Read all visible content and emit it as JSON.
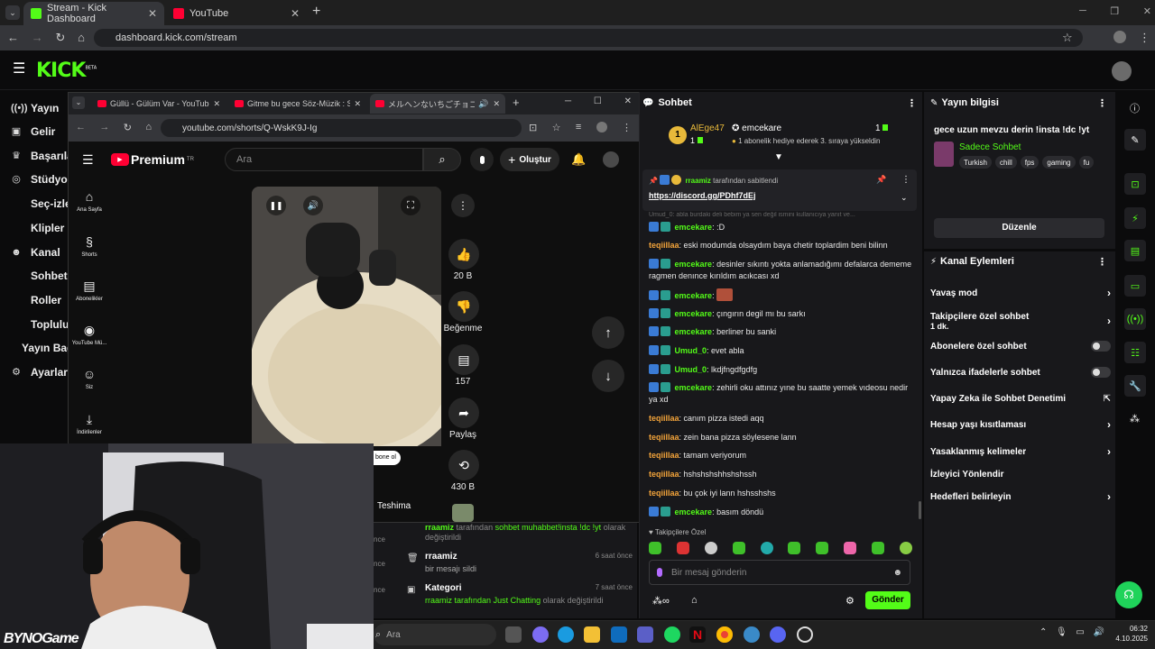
{
  "browser": {
    "tabs": [
      {
        "title": "Stream - Kick Dashboard",
        "active": true
      },
      {
        "title": "YouTube",
        "active": false
      }
    ],
    "url": "dashboard.kick.com/stream",
    "new_tab": "+"
  },
  "kick": {
    "logo": "KICK",
    "logo_badge": "BETA",
    "nav": [
      {
        "label": "Yayın",
        "icon": "broadcast-icon"
      },
      {
        "label": "Gelir",
        "icon": "money-icon"
      },
      {
        "label": "Başarıla",
        "icon": "trophy-icon"
      },
      {
        "label": "Stüdyo",
        "icon": "studio-icon"
      },
      {
        "label": "Seç-izle",
        "icon": ""
      },
      {
        "label": "Klipler",
        "icon": ""
      },
      {
        "label": "Kanal",
        "icon": "people-icon"
      },
      {
        "label": "Sohbet",
        "icon": ""
      },
      {
        "label": "Roller",
        "icon": ""
      },
      {
        "label": "Topluluk",
        "icon": ""
      },
      {
        "label": "Yayın Bağ",
        "icon": ""
      },
      {
        "label": "Ayarlar",
        "icon": "gear-icon"
      }
    ]
  },
  "youtube_window": {
    "tabs": [
      {
        "title": "Güllü - Gülüm Var - YouTube"
      },
      {
        "title": "Gitme bu gece Söz-Müzik : Sa"
      },
      {
        "title": "メルヘンないちごチョコクレープ"
      }
    ],
    "url": "youtube.com/shorts/Q-WskK9J-Ig",
    "brand": "Premium",
    "brand_region": "TR",
    "search_placeholder": "Ara",
    "create_label": "Oluştur",
    "sidebar": [
      {
        "label": "Ana Sayfa",
        "icon": "home-icon"
      },
      {
        "label": "Shorts",
        "icon": "shorts-icon"
      },
      {
        "label": "Abonelikler",
        "icon": "subscriptions-icon"
      },
      {
        "label": "YouTube Mü...",
        "icon": "music-icon"
      },
      {
        "label": "Siz",
        "icon": "user-icon"
      },
      {
        "label": "İndirilenler",
        "icon": "download-icon"
      }
    ],
    "actions": [
      {
        "label": "20 B",
        "icon": "like-icon"
      },
      {
        "label": "Beğenme",
        "icon": "dislike-icon"
      },
      {
        "label": "157",
        "icon": "comment-icon"
      },
      {
        "label": "Paylaş",
        "icon": "share-icon"
      },
      {
        "label": "430 B",
        "icon": "remix-icon"
      }
    ],
    "subscribe_partial": "bone ol",
    "channel_partial": "Teshima"
  },
  "chat": {
    "title": "Sohbet",
    "top_gifter": {
      "name": "AlEge47",
      "count": "1",
      "rank": "1"
    },
    "top_sub": {
      "name": "emcekare",
      "count": "1"
    },
    "sub_notice": "1 abonelik hediye ederek 3. sıraya yükseldin",
    "pinned_by_user": "rraamiz",
    "pinned_by_text": "tarafından sabitlendi",
    "pinned_link": "https://discord.gg/PDhf7dEj",
    "faded_line": "Umud_0: abla burdaki deli bebim ya sen değil ismini kullanıcıya yanıt ve...",
    "messages": [
      {
        "user": "emcekare",
        "text": ": :D",
        "badges": true,
        "color": "#53fc18"
      },
      {
        "user": "teqiillaa",
        "text": ": eski modumda olsaydım baya chetir toplardim beni bilinn",
        "badges": false,
        "color": "#f2a33a"
      },
      {
        "user": "emcekare",
        "text": ": desinler sıkıntı yokta anlamadığımı defalarca dememe ragmen denınce kırıldım acıkcası xd",
        "badges": true,
        "color": "#53fc18"
      },
      {
        "user": "emcekare",
        "text": ":",
        "badges": true,
        "color": "#53fc18"
      },
      {
        "user": "emcekare",
        "text": ": çıngırın degil mı bu sarkı",
        "badges": true,
        "color": "#53fc18"
      },
      {
        "user": "emcekare",
        "text": ": berliner bu sanki",
        "badges": true,
        "color": "#53fc18"
      },
      {
        "user": "Umud_0",
        "text": ": evet abla",
        "badges": true,
        "color": "#53fc18"
      },
      {
        "user": "Umud_0",
        "text": ": lkdjfngdfgdfg",
        "badges": true,
        "color": "#53fc18"
      },
      {
        "user": "emcekare",
        "text": ": zehirli oku attınız yıne bu saatte yemek vıdeosu nedir ya xd",
        "badges": true,
        "color": "#53fc18"
      },
      {
        "user": "teqiillaa",
        "text": ": canım pizza istedi aqq",
        "badges": false,
        "color": "#f2a33a"
      },
      {
        "user": "teqiillaa",
        "text": ": zein bana pizza söylesene lann",
        "badges": false,
        "color": "#f2a33a"
      },
      {
        "user": "teqiillaa",
        "text": ": tamam veriyorum",
        "badges": false,
        "color": "#f2a33a"
      },
      {
        "user": "teqiillaa",
        "text": ": hshshshshhshshssh",
        "badges": false,
        "color": "#f2a33a"
      },
      {
        "user": "teqiillaa",
        "text": ": bu çok iyi lann hshsshshs",
        "badges": false,
        "color": "#f2a33a"
      },
      {
        "user": "emcekare",
        "text": ": basım döndü",
        "badges": true,
        "color": "#53fc18"
      }
    ],
    "followers_label": "Takipçilere Özel",
    "input_placeholder": "Bir mesaj gönderin",
    "send_label": "Gönder"
  },
  "stream_info": {
    "title": "Yayın bilgisi",
    "stream_title": "gece uzun mevzu derin !insta !dc !yt",
    "category": "Sadece Sohbet",
    "tags": [
      "Turkish",
      "chill",
      "fps",
      "gaming",
      "fu"
    ],
    "edit_label": "Düzenle"
  },
  "channel_actions": {
    "title": "Kanal Eylemleri",
    "items": [
      {
        "label": "Yavaş mod",
        "sub": "",
        "control": "chevron"
      },
      {
        "label": "Takipçilere özel sohbet",
        "sub": "1 dk.",
        "control": "chevron"
      },
      {
        "label": "Abonelere özel sohbet",
        "sub": "",
        "control": "toggle"
      },
      {
        "label": "Yalnızca ifadelerle sohbet",
        "sub": "",
        "control": "toggle"
      },
      {
        "label": "Yapay Zeka ile Sohbet Denetimi",
        "sub": "",
        "control": "external"
      },
      {
        "label": "Hesap yaşı kısıtlaması",
        "sub": "",
        "control": "chevron"
      },
      {
        "label": "Yasaklanmış kelimeler",
        "sub": "",
        "control": "chevron"
      },
      {
        "label": "İzleyici Yönlendir",
        "sub": "",
        "control": "none"
      },
      {
        "label": "Hedefleri belirleyin",
        "sub": "",
        "control": "chevron"
      }
    ]
  },
  "activity": [
    {
      "user": "rraamiz",
      "text1": "tarafından",
      "highlight": "sohbet muhabbet!insta !dc !yt",
      "text2": "olarak değiştirildi",
      "time": ""
    },
    {
      "user": "rraamiz",
      "text1": "bir mesajı sildi",
      "highlight": "",
      "text2": "",
      "time": "6 saat önce"
    },
    {
      "user": "Kategori",
      "text1": "rraamiz tarafından",
      "highlight": "Just Chatting",
      "text2": "olarak değiştirildi",
      "time": "7 saat önce"
    }
  ],
  "activity_partial": [
    "nce",
    "nce",
    "nce"
  ],
  "taskbar": {
    "search_placeholder": "Ara",
    "time": "06:32",
    "date": "4.10.2025"
  },
  "webcam": {
    "watermark": "BYNOGame"
  },
  "colors": {
    "kick_green": "#53fc18",
    "panel": "#18181b",
    "yt_red": "#ff0033"
  }
}
